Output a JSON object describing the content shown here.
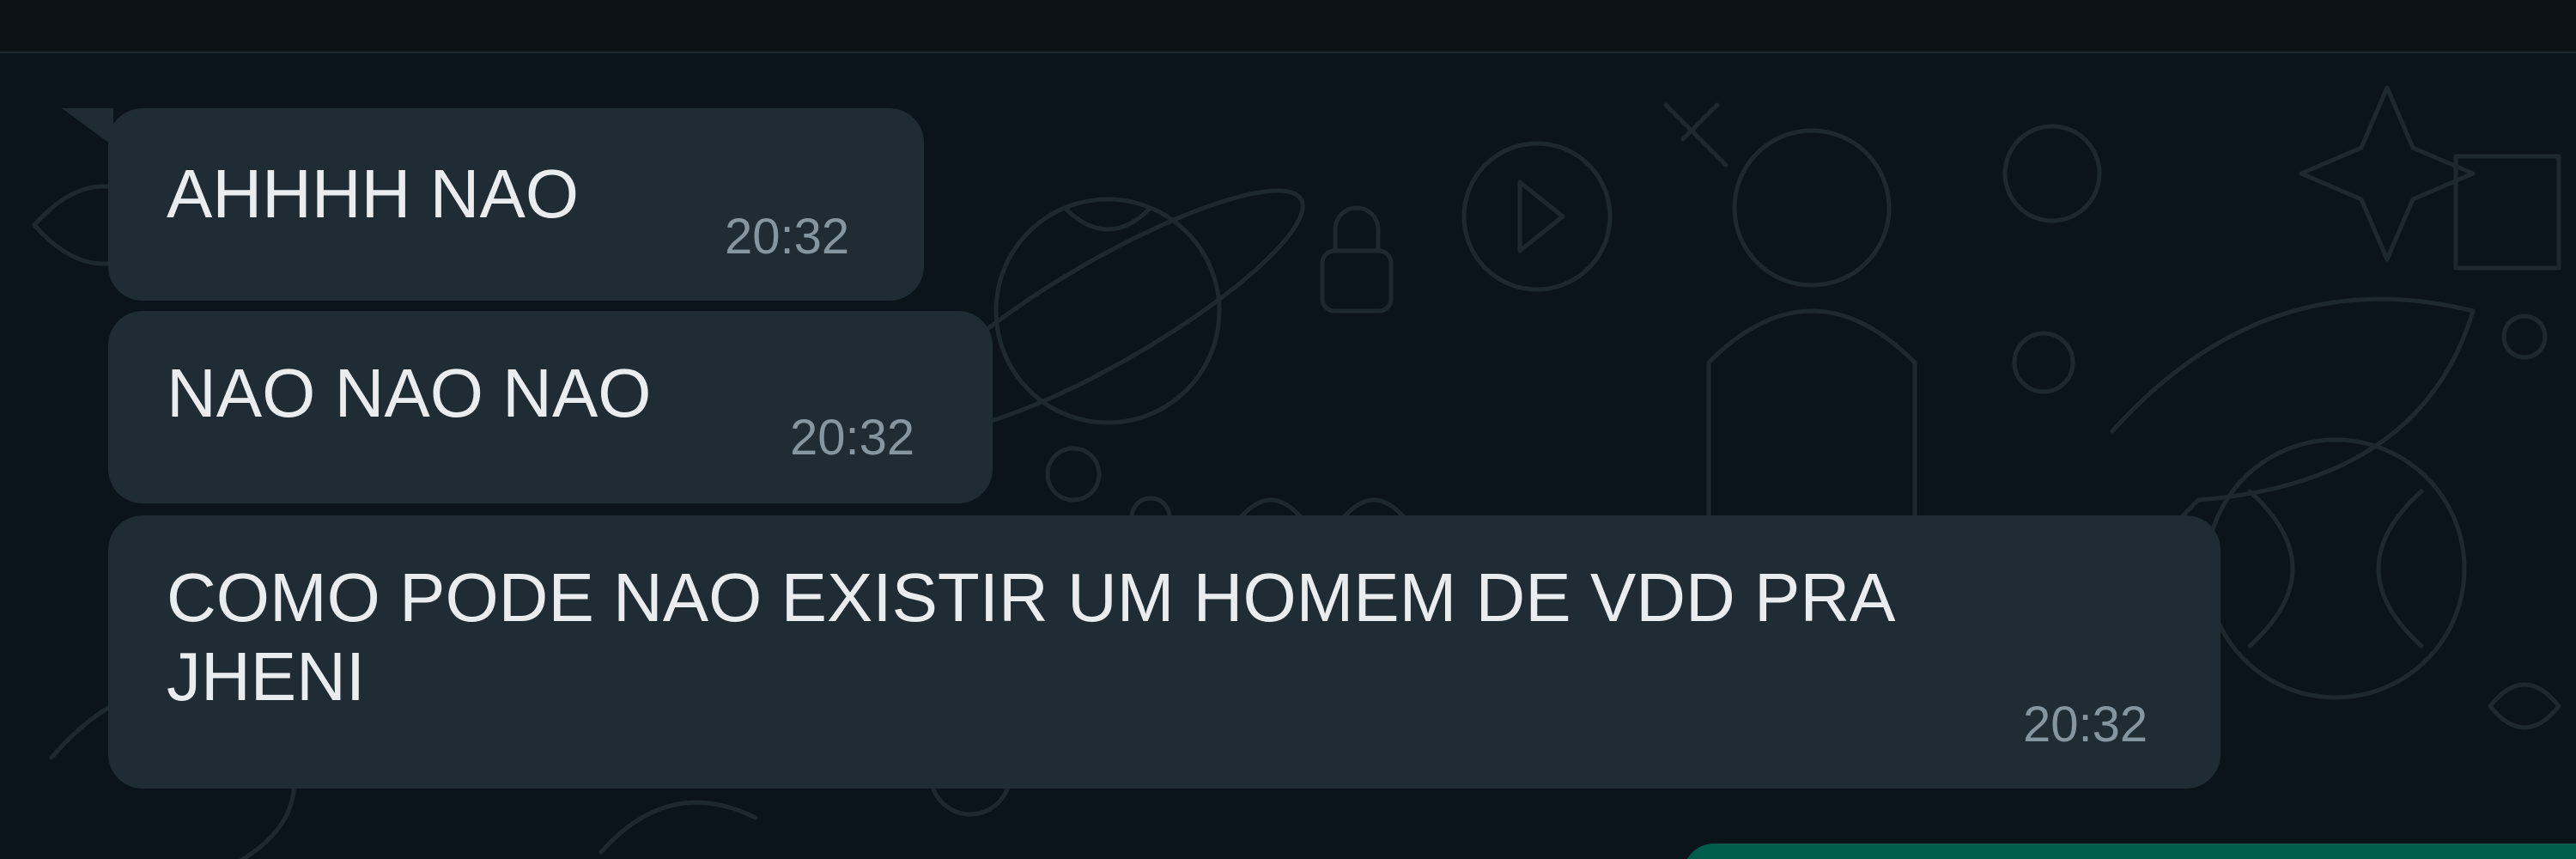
{
  "chat": {
    "messages": [
      {
        "text": "AHHHH NAO",
        "time": "20:32"
      },
      {
        "text": "NAO NAO NAO",
        "time": "20:32"
      },
      {
        "text": "COMO PODE NAO EXISTIR UM HOMEM DE VDD PRA\nJHENI",
        "time": "20:32"
      }
    ]
  },
  "colors": {
    "background": "#0b141a",
    "incoming_bubble": "#202c33",
    "outgoing_bubble": "#005c4b",
    "message_text": "#e9edef",
    "timestamp_text": "#8696a0",
    "wallpaper_doodles": "#1e292f"
  }
}
